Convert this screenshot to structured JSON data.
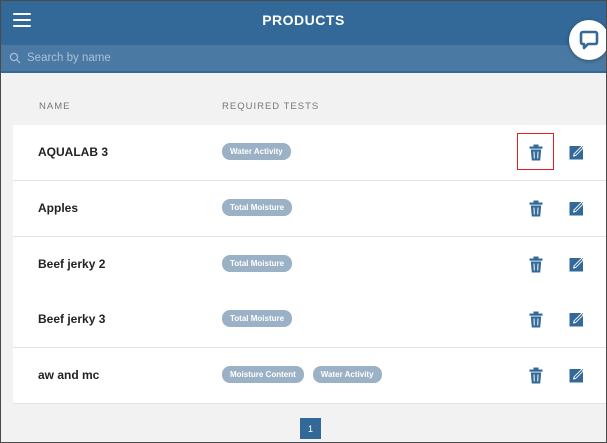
{
  "header": {
    "title": "PRODUCTS",
    "menu_icon": "hamburger-menu-icon",
    "search": {
      "placeholder": "Search by name",
      "value": ""
    },
    "chat_icon": "chat-bubble-icon"
  },
  "table": {
    "columns": [
      "NAME",
      "REQUIRED TESTS"
    ],
    "rows": [
      {
        "name": "AQUALAB 3",
        "tests": [
          "Water Activity"
        ],
        "highlighted": true
      },
      {
        "name": "Apples",
        "tests": [
          "Total Moisture"
        ]
      },
      {
        "name": "Beef jerky 2",
        "tests": [
          "Total Moisture"
        ]
      },
      {
        "name": "Beef jerky 3",
        "tests": [
          "Total Moisture"
        ]
      },
      {
        "name": "aw and mc",
        "tests": [
          "Moisture Content",
          "Water Activity"
        ]
      }
    ],
    "actions": [
      "trash-icon",
      "edit-icon"
    ]
  },
  "pagination": {
    "current": "1"
  },
  "colors": {
    "brand": "#336998",
    "tag": "#9ab1c6",
    "highlight": "#e02020"
  }
}
